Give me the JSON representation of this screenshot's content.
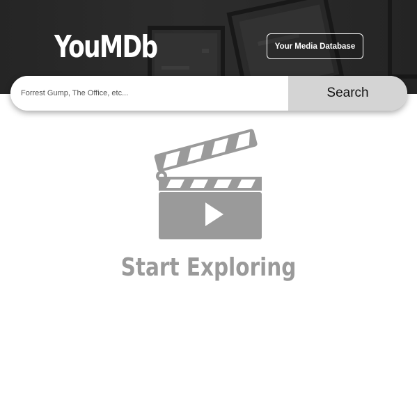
{
  "header": {
    "brand": "YouMDb",
    "tagline_button": "Your Media Database"
  },
  "search": {
    "placeholder": "Forrest Gump, The Office, etc...",
    "value": "",
    "button_label": "Search"
  },
  "empty_state": {
    "icon": "clapperboard-play-icon",
    "title": "Start Exploring"
  },
  "colors": {
    "hero_background": "#2e2e2e",
    "search_button_bg": "#d4d4d4",
    "icon_gray": "#9a9a9a",
    "text_white": "#ffffff"
  }
}
